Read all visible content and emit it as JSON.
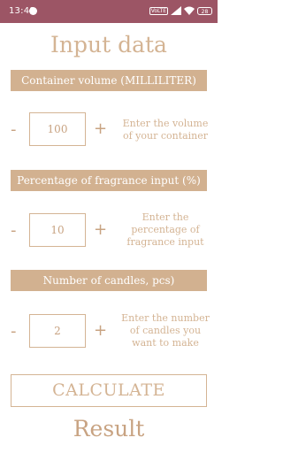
{
  "status_bar": {
    "time": "13:49",
    "vowifi": "VoLTE",
    "battery": "28"
  },
  "title": "Input data",
  "fields": [
    {
      "label": "Container volume (MILLILITER)",
      "value": "100",
      "minus": "-",
      "plus": "+",
      "hint": "Enter the volume of your container"
    },
    {
      "label": "Percentage of fragrance input (%)",
      "value": "10",
      "minus": "-",
      "plus": "+",
      "hint": "Enter the percentage of fragrance input"
    },
    {
      "label": "Number of candles, pcs)",
      "value": "2",
      "minus": "-",
      "plus": "+",
      "hint": "Enter the number of candles you want to make"
    }
  ],
  "calculate_label": "CALCULATE",
  "result_label": "Result",
  "colors": {
    "status_bar": "#9c5565",
    "accent": "#d2b190",
    "text": "#d4b494"
  },
  "icons": [
    "media-icon",
    "vowifi-icon",
    "signal-icon",
    "wifi-icon",
    "battery-icon"
  ]
}
